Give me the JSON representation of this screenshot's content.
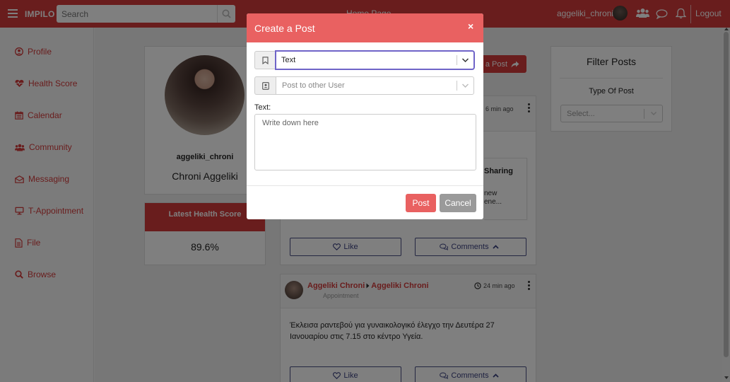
{
  "topbar": {
    "brand": "IMPILO",
    "search_placeholder": "Search",
    "home_title": "Home Page",
    "username": "aggeliki_chroni",
    "logout": "Logout"
  },
  "sidebar": {
    "items": [
      {
        "label": "Profile",
        "icon": "user-circle-icon"
      },
      {
        "label": "Health Score",
        "icon": "heartbeat-icon"
      },
      {
        "label": "Calendar",
        "icon": "calendar-icon"
      },
      {
        "label": "Community",
        "icon": "users-icon"
      },
      {
        "label": "Messaging",
        "icon": "envelope-icon"
      },
      {
        "label": "T-Appointment",
        "icon": "desktop-icon"
      },
      {
        "label": "File",
        "icon": "file-icon"
      },
      {
        "label": "Browse",
        "icon": "search-icon"
      }
    ]
  },
  "profile": {
    "username": "aggeliki_chroni",
    "full_name": "Chroni Aggeliki"
  },
  "health": {
    "header": "Latest Health Score",
    "value": "89.6%"
  },
  "feed": {
    "create_button": "e a Post",
    "post1": {
      "time": "6 min ago",
      "share_title": "Sharing",
      "share_line1": "new",
      "share_line2": "ene...",
      "like": "Like",
      "comments": "Comments"
    },
    "post2": {
      "author": "Aggeliki Chroni",
      "target": "Aggeliki Chroni",
      "type": "Appointment",
      "time": "24 min ago",
      "text_line1": "Έκλεισα ραντεβού για γυναικολογικό έλεγχο την Δευτέρα 27",
      "text_line2": "Ιανουαρίου στις 7.15 στο κέντρο Υγεία.",
      "like": "Like",
      "comments": "Comments"
    }
  },
  "filter": {
    "title": "Filter Posts",
    "label": "Type Of Post",
    "placeholder": "Select..."
  },
  "modal": {
    "title": "Create a Post",
    "close": "×",
    "post_type_value": "Text",
    "target_placeholder": "Post to other User",
    "text_label": "Text:",
    "text_placeholder": "Write down here",
    "post_button": "Post",
    "cancel_button": "Cancel"
  },
  "colors": {
    "brand_red": "#d33a3a",
    "modal_red": "#e96161",
    "link_navy": "#3d4281",
    "focus_purple": "#6f64c8"
  }
}
